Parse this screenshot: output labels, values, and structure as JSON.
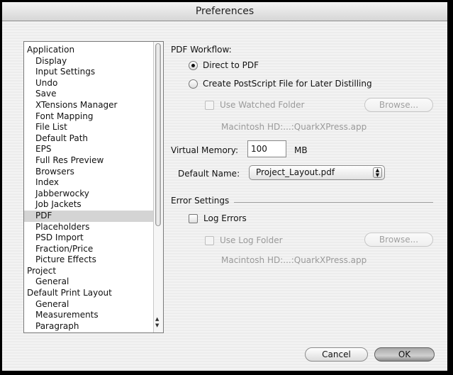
{
  "window": {
    "title": "Preferences"
  },
  "sidebar": {
    "items": [
      {
        "label": "Application",
        "level": 0
      },
      {
        "label": "Display",
        "level": 1
      },
      {
        "label": "Input Settings",
        "level": 1
      },
      {
        "label": "Undo",
        "level": 1
      },
      {
        "label": "Save",
        "level": 1
      },
      {
        "label": "XTensions Manager",
        "level": 1
      },
      {
        "label": "Font Mapping",
        "level": 1
      },
      {
        "label": "File List",
        "level": 1
      },
      {
        "label": "Default Path",
        "level": 1
      },
      {
        "label": "EPS",
        "level": 1
      },
      {
        "label": "Full Res Preview",
        "level": 1
      },
      {
        "label": "Browsers",
        "level": 1
      },
      {
        "label": "Index",
        "level": 1
      },
      {
        "label": "Jabberwocky",
        "level": 1
      },
      {
        "label": "Job Jackets",
        "level": 1
      },
      {
        "label": "PDF",
        "level": 1,
        "selected": true
      },
      {
        "label": "Placeholders",
        "level": 1
      },
      {
        "label": "PSD Import",
        "level": 1
      },
      {
        "label": "Fraction/Price",
        "level": 1
      },
      {
        "label": "Picture Effects",
        "level": 1
      },
      {
        "label": "Project",
        "level": 0
      },
      {
        "label": "General",
        "level": 1
      },
      {
        "label": "Default Print Layout",
        "level": 0
      },
      {
        "label": "General",
        "level": 1
      },
      {
        "label": "Measurements",
        "level": 1
      },
      {
        "label": "Paragraph",
        "level": 1
      }
    ]
  },
  "pdf_workflow": {
    "label": "PDF Workflow:",
    "direct_label": "Direct to PDF",
    "direct_selected": true,
    "postscript_label": "Create PostScript File for Later Distilling",
    "postscript_selected": false,
    "watched_folder_label": "Use Watched Folder",
    "watched_browse_label": "Browse...",
    "watched_path": "Macintosh HD:...:QuarkXPress.app"
  },
  "virtual_memory": {
    "label": "Virtual Memory:",
    "value": "100",
    "unit": "MB"
  },
  "default_name": {
    "label": "Default Name:",
    "value": "Project_Layout.pdf"
  },
  "error_settings": {
    "label": "Error Settings",
    "log_errors_label": "Log Errors",
    "log_folder_label": "Use Log Folder",
    "log_browse_label": "Browse...",
    "log_path": "Macintosh HD:...:QuarkXPress.app"
  },
  "footer": {
    "cancel_label": "Cancel",
    "ok_label": "OK"
  }
}
